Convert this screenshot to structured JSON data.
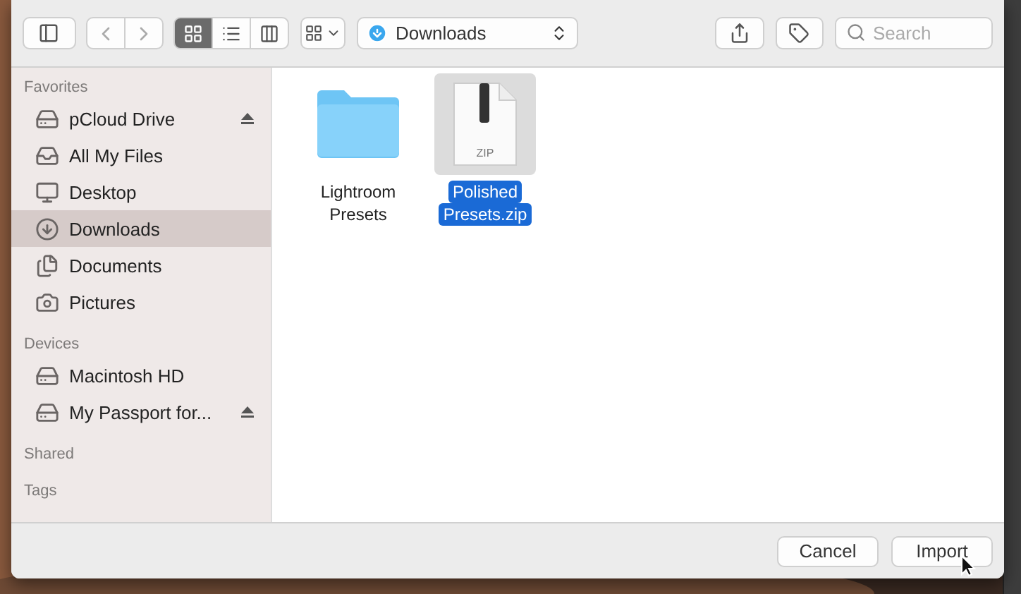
{
  "toolbar": {
    "view_modes": [
      {
        "kind": "icons",
        "selected": true
      },
      {
        "kind": "list",
        "selected": false
      },
      {
        "kind": "columns",
        "selected": false
      }
    ],
    "location": "Downloads",
    "search": {
      "placeholder": "Search"
    }
  },
  "sidebar": [
    {
      "title": "Favorites",
      "items": [
        {
          "label": "pCloud Drive",
          "kind": "drive",
          "selected": false,
          "eject": true
        },
        {
          "label": "All My Files",
          "kind": "files",
          "selected": false,
          "eject": false
        },
        {
          "label": "Desktop",
          "kind": "desktop",
          "selected": false,
          "eject": false
        },
        {
          "label": "Downloads",
          "kind": "downloads",
          "selected": true,
          "eject": false
        },
        {
          "label": "Documents",
          "kind": "documents",
          "selected": false,
          "eject": false
        },
        {
          "label": "Pictures",
          "kind": "pictures",
          "selected": false,
          "eject": false
        }
      ]
    },
    {
      "title": "Devices",
      "items": [
        {
          "label": "Macintosh HD",
          "kind": "disk",
          "selected": false,
          "eject": false
        },
        {
          "label": "My Passport for...",
          "kind": "disk",
          "selected": false,
          "eject": true
        }
      ]
    },
    {
      "title": "Shared"
    },
    {
      "title": "Tags"
    }
  ],
  "files": [
    {
      "kind": "folder",
      "name_lines": [
        "Lightroom",
        "Presets"
      ],
      "selected": false
    },
    {
      "kind": "zip",
      "badge": "ZIP",
      "name_lines": [
        "Polished",
        "Presets.zip"
      ],
      "selected": true
    }
  ],
  "buttons": [
    {
      "label": "Cancel",
      "default": false
    },
    {
      "label": "Import",
      "default": false
    }
  ]
}
